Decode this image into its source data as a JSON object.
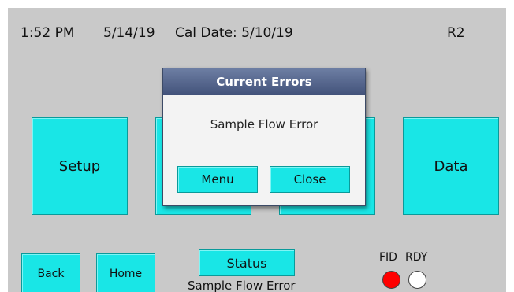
{
  "header": {
    "time": "1:52 PM",
    "date": "5/14/19",
    "cal_date": "Cal Date: 5/10/19",
    "range": "R2"
  },
  "tiles": {
    "setup": "Setup",
    "data": "Data"
  },
  "dialog": {
    "title": "Current Errors",
    "message": "Sample Flow Error",
    "menu_label": "Menu",
    "close_label": "Close"
  },
  "footer": {
    "back_label": "Back",
    "home_label": "Home",
    "status_label": "Status",
    "status_message": "Sample Flow Error",
    "fid_label": "FID",
    "rdy_label": "RDY"
  },
  "indicators": {
    "fid_color": "#ff0000",
    "rdy_color": "#ffffff"
  },
  "colors": {
    "button": "#19e6e6",
    "dialog_header": "#52638a"
  }
}
